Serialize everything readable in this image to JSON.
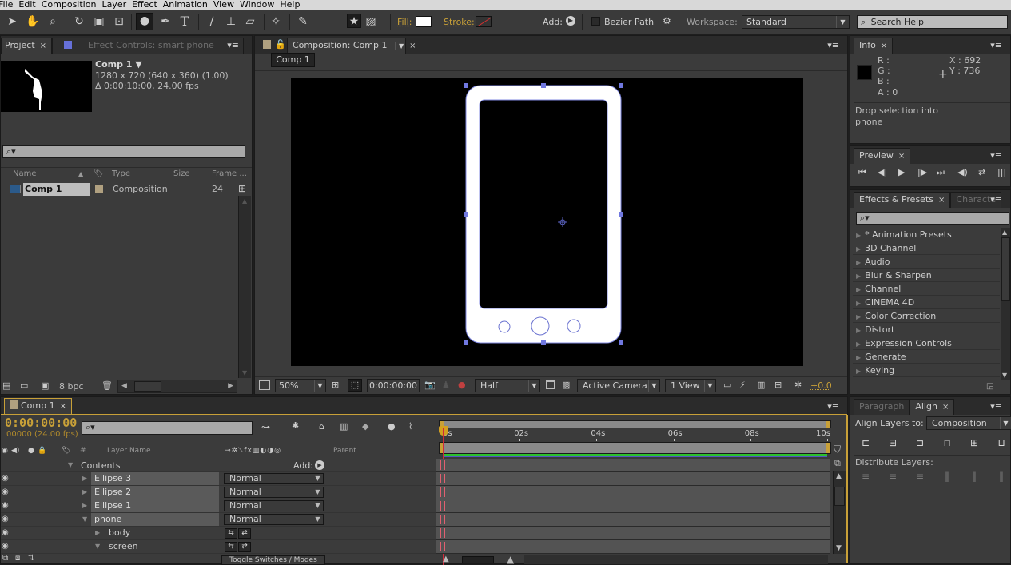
{
  "menu": [
    "File",
    "Edit",
    "Composition",
    "Layer",
    "Effect",
    "Animation",
    "View",
    "Window",
    "Help"
  ],
  "toolbar": {
    "tools": [
      {
        "name": "selection-tool-icon",
        "glyph": "➤"
      },
      {
        "name": "hand-tool-icon",
        "glyph": "✋"
      },
      {
        "name": "zoom-tool-icon",
        "glyph": "🔍"
      },
      {
        "name": "rotation-tool-icon",
        "glyph": "↻"
      },
      {
        "name": "camera-tool-icon",
        "glyph": "▣"
      },
      {
        "name": "pan-behind-tool-icon",
        "glyph": "⊡"
      },
      {
        "name": "ellipse-tool-icon",
        "glyph": "●"
      },
      {
        "name": "pen-tool-icon",
        "glyph": "✒"
      },
      {
        "name": "type-tool-icon",
        "glyph": "T"
      },
      {
        "name": "brush-tool-icon",
        "glyph": "∕"
      },
      {
        "name": "clone-stamp-tool-icon",
        "glyph": "⊥"
      },
      {
        "name": "eraser-tool-icon",
        "glyph": "▱"
      },
      {
        "name": "roto-brush-tool-icon",
        "glyph": "✧"
      },
      {
        "name": "puppet-pin-tool-icon",
        "glyph": "✎"
      },
      {
        "name": "star-tool-icon",
        "glyph": "★"
      },
      {
        "name": "mask-tool-icon",
        "glyph": "▨"
      }
    ],
    "fill_label": "Fill:",
    "stroke_label": "Stroke:",
    "add_label": "Add:",
    "bezier_label": "Bezier Path",
    "workspace_label": "Workspace:",
    "workspace_value": "Standard",
    "search_placeholder": "Search Help",
    "fill_color": "#ffffff"
  },
  "project": {
    "tabs": [
      {
        "label": "Project"
      },
      {
        "label": "Effect Controls: smart phone"
      }
    ],
    "comp_name": "Comp 1 ▼",
    "comp_dims": "1280 x 720  (640 x 360) (1.00)",
    "comp_duration": "Δ 0:00:10:00, 24.00 fps",
    "columns": [
      "Name",
      "Type",
      "Size",
      "Frame ..."
    ],
    "items": [
      {
        "name": "Comp 1",
        "type": "Composition",
        "size": "",
        "frame": "24"
      }
    ],
    "bpc": "8 bpc"
  },
  "composition": {
    "tab_label": "Composition: Comp 1",
    "breadcrumb": "Comp 1",
    "zoom": "50%",
    "timecode": "0:00:00:00",
    "resolution": "Half",
    "camera": "Active Camera",
    "views": "1 View",
    "exposure": "+0.0"
  },
  "info": {
    "tab_label": "Info",
    "r": "R :",
    "g": "G :",
    "b": "B :",
    "a": "A : 0",
    "x": "X : 692",
    "y": "Y : 736",
    "message": "Drop selection into phone"
  },
  "preview": {
    "tab_label": "Preview",
    "controls": [
      {
        "name": "first-frame-icon",
        "glyph": "⏮"
      },
      {
        "name": "previous-frame-icon",
        "glyph": "◀|"
      },
      {
        "name": "play-icon",
        "glyph": "▶"
      },
      {
        "name": "next-frame-icon",
        "glyph": "|▶"
      },
      {
        "name": "last-frame-icon",
        "glyph": "⏭"
      },
      {
        "name": "audio-icon",
        "glyph": "◀)"
      },
      {
        "name": "loop-icon",
        "glyph": "⇄"
      },
      {
        "name": "ram-preview-icon",
        "glyph": "|||▶"
      }
    ]
  },
  "effects": {
    "tabs": [
      {
        "label": "Effects & Presets"
      },
      {
        "label": "Characte"
      }
    ],
    "items": [
      "* Animation Presets",
      "3D Channel",
      "Audio",
      "Blur & Sharpen",
      "Channel",
      "CINEMA 4D",
      "Color Correction",
      "Distort",
      "Expression Controls",
      "Generate",
      "Keying"
    ]
  },
  "align": {
    "tabs": [
      {
        "label": "Paragraph"
      },
      {
        "label": "Align"
      }
    ],
    "align_to_label": "Align Layers to:",
    "align_to_value": "Composition",
    "distribute_label": "Distribute Layers:"
  },
  "timeline": {
    "tab_label": "Comp 1",
    "timecode": "0:00:00:00",
    "frames": "00000 (24.00 fps)",
    "columns": {
      "layer_name": "Layer Name",
      "parent": "Parent",
      "hash": "#"
    },
    "contents_label": "Contents",
    "add_label": "Add:",
    "layers": [
      {
        "name": "Ellipse 3",
        "mode": "Normal",
        "expanded": false
      },
      {
        "name": "Ellipse 2",
        "mode": "Normal",
        "expanded": false
      },
      {
        "name": "Ellipse 1",
        "mode": "Normal",
        "expanded": false
      },
      {
        "name": "phone",
        "mode": "Normal",
        "expanded": true
      }
    ],
    "sublayers": [
      {
        "name": "body",
        "expanded": false
      },
      {
        "name": "screen",
        "expanded": true
      }
    ],
    "ruler": [
      "0s",
      "02s",
      "04s",
      "06s",
      "08s",
      "10s"
    ],
    "toggle_label": "Toggle Switches / Modes",
    "accent": "#c8a038"
  }
}
